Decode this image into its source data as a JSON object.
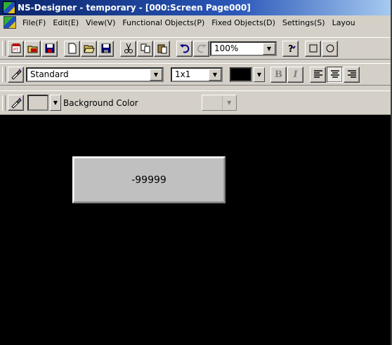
{
  "window": {
    "title": "NS-Designer - temporary - [000:Screen Page000]"
  },
  "menu": {
    "items": [
      {
        "label": "File(F)",
        "name": "menu-file"
      },
      {
        "label": "Edit(E)",
        "name": "menu-edit"
      },
      {
        "label": "View(V)",
        "name": "menu-view"
      },
      {
        "label": "Functional Objects(P)",
        "name": "menu-functional-objects"
      },
      {
        "label": "Fixed Objects(D)",
        "name": "menu-fixed-objects"
      },
      {
        "label": "Settings(S)",
        "name": "menu-settings"
      },
      {
        "label": "Layou",
        "name": "menu-layout"
      }
    ]
  },
  "toolbar": {
    "zoom_value": "100%",
    "icons": [
      "transfer-icon",
      "open-project-icon",
      "save-project-icon",
      "new-icon",
      "open-icon",
      "save-icon",
      "cut-icon",
      "copy-icon",
      "paste-icon",
      "undo-icon",
      "redo-icon",
      "help-icon",
      "rectangle-icon",
      "circle-icon"
    ]
  },
  "format_toolbar": {
    "font_value": "Standard",
    "scale_value": "1x1",
    "text_color": "#000000",
    "bold_label": "B",
    "italic_label": "I"
  },
  "background_toolbar": {
    "label": "Background Color",
    "bg_swatch_color": "#c0c0c0"
  },
  "canvas": {
    "background": "#000000",
    "numeric_display_value": "-99999"
  }
}
